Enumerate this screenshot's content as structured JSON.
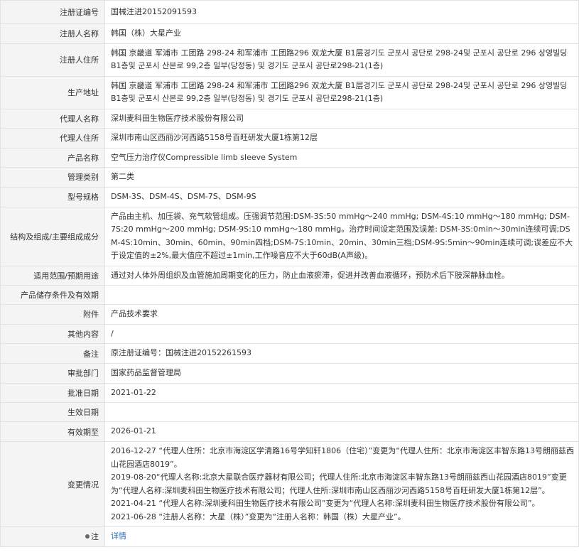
{
  "rows": [
    {
      "label": "注册证编号",
      "value": "国械注进20152091593"
    },
    {
      "label": "注册人名称",
      "value": "韩国（株）大星产业"
    },
    {
      "label": "注册人住所",
      "value": "韩国 京畿道 军浦市 工团路 298-24 和军浦市 工团路296 双龙大厦 B1层경기도 군포시 공단로 298-24및 군포시 공단로 296 상영빌딩 B1층및 군포시 산본로 99,2층 일부(당정동) 및 경기도 군포시 공단로298-21(1층)"
    },
    {
      "label": "生产地址",
      "value": "韩国 京畿道 军浦市 工团路 298-24 和军浦市 工团路296 双龙大厦 B1层경기도 군포시 공단로 298-24및 군포시 공단로 296 상영빌딩 B1층및 군포시 산본로 99,2층 일부(당정동) 및 경기도 군포시 공단로298-21(1층)"
    },
    {
      "label": "代理人名称",
      "value": "深圳麦科田生物医疗技术股份有限公司"
    },
    {
      "label": "代理人住所",
      "value": "深圳市南山区西丽沙河西路5158号百旺研发大厦1栋第12层"
    },
    {
      "label": "产品名称",
      "value": "空气压力治疗仪Compressible limb sleeve System"
    },
    {
      "label": "管理类别",
      "value": "第二类"
    },
    {
      "label": "型号规格",
      "value": "DSM-3S、DSM-4S、DSM-7S、DSM-9S"
    },
    {
      "label": "结构及组成/主要组成成分",
      "value": "产品由主机、加压袋、充气软管组成。压强调节范围:DSM-3S:50 mmHg～240 mmHg; DSM-4S:10 mmHg～180 mmHg; DSM-7S:20 mmHg～200 mmHg; DSM-9S:10 mmHg～180 mmHg。治疗时间设定范围及误差: DSM-3S:0min～30min连续可调;DSM-4S:10min、30min、60min、90min四档;DSM-7S:10min、20min、30min三档;DSM-9S:5min～90min连续可调;误差应不大于设定值的±2%,最大值应不超过±1min,工作噪音应不大于60dB(A声级)。"
    },
    {
      "label": "适用范围/预期用途",
      "value": "通过对人体外周组织及血管施加周期变化的压力，防止血液瘀滞，促进并改善血液循环，预防术后下肢深静脉血栓。"
    },
    {
      "label": "产品储存条件及有效期",
      "value": ""
    },
    {
      "label": "附件",
      "value": "产品技术要求"
    },
    {
      "label": "其他内容",
      "value": "/"
    },
    {
      "label": "备注",
      "value": "原注册证编号：国械注进20152261593"
    },
    {
      "label": "审批部门",
      "value": "国家药品监督管理局"
    },
    {
      "label": "批准日期",
      "value": "2021-01-22"
    },
    {
      "label": "生效日期",
      "value": ""
    },
    {
      "label": "有效期至",
      "value": "2026-01-21"
    }
  ],
  "changes": {
    "label": "变更情况",
    "lines": [
      "2016-12-27 “代理人住所：北京市海淀区学清路16号学知轩1806（住宅）”变更为“代理人住所：北京市海淀区丰智东路13号朗丽兹西山花园酒店8019”。",
      "2019-08-20“代理人名称:北京大星联合医疗器材有限公司；代理人住所:北京市海淀区丰智东路13号朗丽兹西山花园酒店8019”变更为“代理人名称:深圳麦科田生物医疗技术有限公司；代理人住所:深圳市南山区西丽沙河西路5158号百旺研发大厦1栋第12层”。",
      "2021-04-21 “代理人名称:深圳麦科田生物医疗技术有限公司”变更为“代理人名称:深圳麦科田生物医疗技术股份有限公司”。",
      "2021-06-28 “注册人名称：大星（株）”变更为“注册人名称：韩国（株）大星产业”。"
    ]
  },
  "note": {
    "icon": "bulb-icon",
    "label": "注",
    "link": "详情",
    "link_color": "#2f6cb5"
  }
}
